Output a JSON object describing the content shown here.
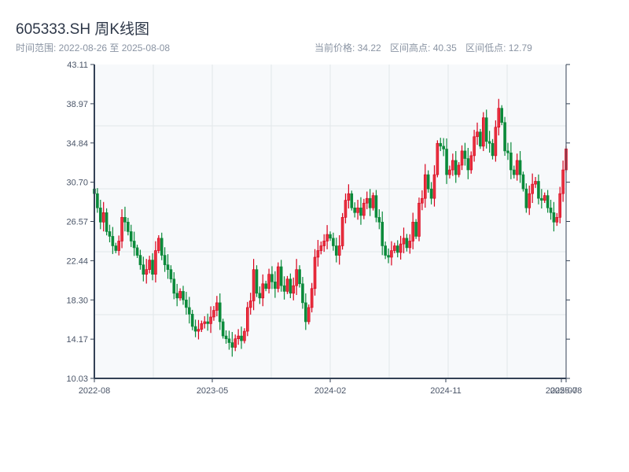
{
  "header": {
    "title": "605333.SH 周K线图",
    "range_text": "时间范围: 2022-08-26 至 2025-08-08",
    "current_price": "当前价格: 34.22",
    "range_high": "区间高点: 40.35",
    "range_low": "区间低点: 12.79"
  },
  "chart_data": {
    "type": "candlestick",
    "frequency": "weekly",
    "x_range": [
      "2022-08-26",
      "2025-08-08"
    ],
    "ylim": [
      10.03,
      43.11
    ],
    "y_ticks": [
      "43.11",
      "38.97",
      "34.84",
      "30.70",
      "26.57",
      "22.44",
      "18.30",
      "14.17",
      "10.03"
    ],
    "x_ticks": [
      "2022-08",
      "2023-05",
      "2024-02",
      "2024-11",
      "2025-07",
      "2025-08"
    ],
    "up_color": "#d9001b",
    "down_color": "#0a8a3a",
    "grid": true,
    "closes": [
      29.5,
      28.0,
      26.5,
      27.5,
      25.5,
      25.0,
      24.0,
      23.5,
      24.5,
      27.0,
      26.5,
      25.5,
      24.5,
      23.8,
      23.0,
      22.0,
      21.0,
      21.5,
      22.5,
      21.0,
      23.5,
      24.8,
      23.0,
      22.0,
      21.5,
      20.5,
      19.0,
      18.5,
      19.2,
      18.3,
      17.5,
      16.8,
      15.5,
      15.0,
      15.2,
      15.8,
      16.0,
      15.8,
      16.5,
      17.2,
      18.0,
      16.0,
      14.5,
      14.2,
      13.8,
      13.3,
      14.2,
      14.5,
      14.0,
      15.0,
      17.5,
      18.2,
      21.5,
      19.0,
      18.5,
      20.0,
      19.5,
      21.0,
      20.2,
      19.5,
      21.8,
      19.8,
      19.2,
      20.5,
      19.0,
      19.8,
      21.5,
      20.0,
      18.0,
      16.0,
      17.5,
      19.5,
      22.8,
      23.5,
      24.0,
      24.5,
      25.2,
      24.8,
      24.0,
      23.0,
      24.0,
      27.0,
      28.8,
      29.5,
      28.0,
      27.5,
      28.0,
      27.2,
      28.5,
      29.0,
      28.0,
      29.3,
      27.0,
      26.5,
      24.0,
      23.0,
      22.8,
      23.5,
      24.0,
      23.3,
      24.2,
      24.8,
      23.8,
      24.5,
      26.5,
      25.0,
      28.5,
      29.0,
      31.5,
      30.0,
      29.0,
      31.5,
      34.8,
      34.5,
      34.2,
      31.5,
      32.0,
      33.0,
      31.5,
      32.5,
      34.0,
      33.2,
      32.0,
      33.5,
      35.5,
      36.0,
      34.5,
      37.5,
      35.0,
      34.8,
      33.5,
      36.5,
      38.5,
      37.0,
      34.0,
      33.8,
      32.0,
      31.5,
      33.0,
      31.5,
      30.0,
      28.0,
      29.5,
      30.5,
      30.8,
      29.0,
      28.8,
      29.3,
      28.0,
      27.5,
      26.5,
      27.0,
      29.5,
      32.0,
      34.22
    ]
  }
}
